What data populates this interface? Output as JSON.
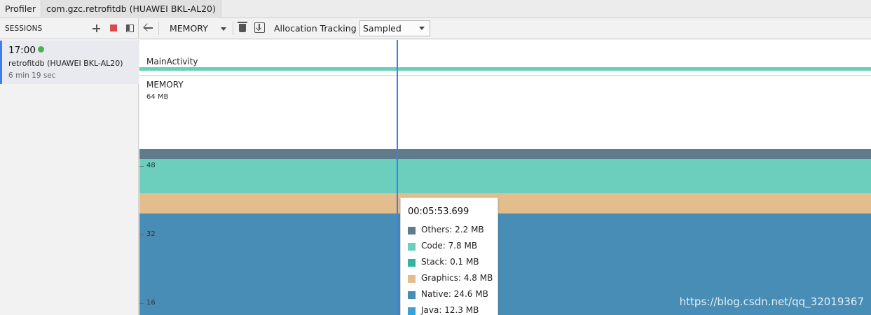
{
  "tabs": [
    {
      "label": "Profiler"
    },
    {
      "label": "com.gzc.retrofitdb (HUAWEI BKL-AL20)"
    }
  ],
  "sessions": {
    "title": "SESSIONS",
    "item": {
      "time": "17:00",
      "name": "retrofitdb (HUAWEI BKL-AL20)",
      "duration": "6 min 19 sec"
    }
  },
  "toolbar": {
    "profiler_selected": "MEMORY",
    "allocation_label": "Allocation Tracking",
    "allocation_selected": "Sampled"
  },
  "timeline": {
    "activity": "MainActivity",
    "memory_label": "MEMORY",
    "axis": {
      "top": "64 MB",
      "l48": "48",
      "l32": "32",
      "l16": "16"
    },
    "watermark": "https://blog.csdn.net/qq_32019367"
  },
  "tooltip": {
    "time": "00:05:53.699",
    "rows": [
      {
        "label": "Others: 2.2 MB",
        "color": "#5f7c8d"
      },
      {
        "label": "Code: 7.8 MB",
        "color": "#6ccfbe"
      },
      {
        "label": "Stack: 0.1 MB",
        "color": "#35b3a0"
      },
      {
        "label": "Graphics: 4.8 MB",
        "color": "#e3bd8b"
      },
      {
        "label": "Native: 24.6 MB",
        "color": "#488db5"
      },
      {
        "label": "Java: 12.3 MB",
        "color": "#3aa1d6"
      }
    ]
  }
}
